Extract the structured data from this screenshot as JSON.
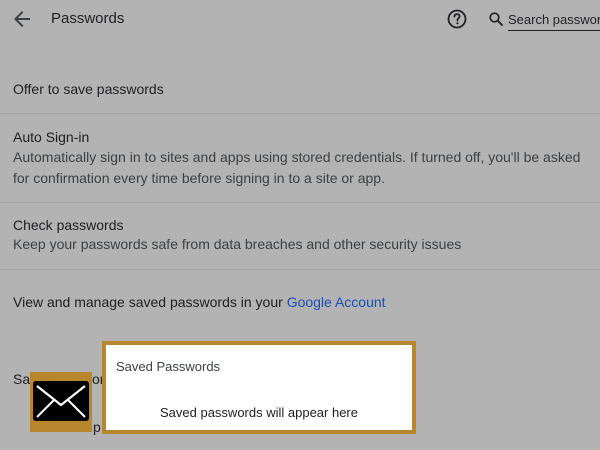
{
  "header": {
    "title": "Passwords",
    "search_placeholder": "Search passwords"
  },
  "rows": {
    "offer": {
      "title": "Offer to save passwords"
    },
    "auto_signin": {
      "title": "Auto Sign-in",
      "description": "Automatically sign in to sites and apps using stored credentials. If turned off, you'll be asked for confirmation every time before signing in to a site or app."
    },
    "check": {
      "title": "Check passwords",
      "description": "Keep your passwords safe from data breaches and other security issues"
    }
  },
  "manage": {
    "prefix": "View and manage saved passwords in your ",
    "link": "Google Account"
  },
  "obscured": {
    "saved_fragment": "Sav",
    "second_fragment": "or",
    "third_fragment": "p"
  },
  "popup": {
    "title": "Saved Passwords",
    "message": "Saved passwords will appear here"
  },
  "icons": {
    "back": "arrow-back-icon",
    "help": "help-circle-icon",
    "search": "search-icon",
    "mail": "envelope-icon"
  },
  "colors": {
    "background": "#b3b3b3",
    "accent_border": "#b8862c",
    "link": "#1a4fb8"
  }
}
